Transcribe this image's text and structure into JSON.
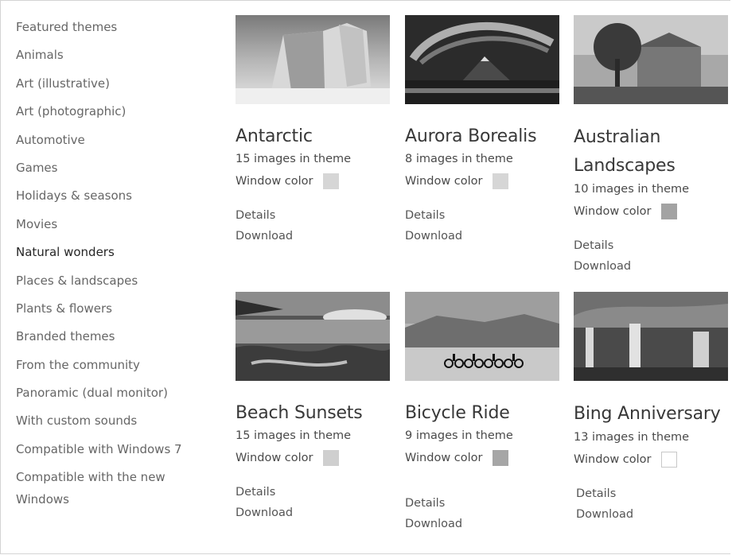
{
  "sidebar": {
    "items": [
      {
        "label": "Featured themes"
      },
      {
        "label": "Animals"
      },
      {
        "label": "Art (illustrative)"
      },
      {
        "label": "Art (photographic)"
      },
      {
        "label": "Automotive"
      },
      {
        "label": "Games"
      },
      {
        "label": "Holidays & seasons"
      },
      {
        "label": "Movies"
      },
      {
        "label": "Natural wonders"
      },
      {
        "label": "Places & landscapes"
      },
      {
        "label": "Plants & flowers"
      },
      {
        "label": "Branded themes"
      },
      {
        "label": "From the community"
      },
      {
        "label": "Panoramic (dual monitor)"
      },
      {
        "label": "With custom sounds"
      },
      {
        "label": "Compatible with Windows 7"
      },
      {
        "label": "Compatible with the new Windows"
      }
    ],
    "active": "Natural wonders"
  },
  "themes": [
    {
      "title": "Antarctic",
      "count": "15 images in theme",
      "window_color_label": "Window color",
      "window_color": "#d6d6d6",
      "details": "Details",
      "download": "Download"
    },
    {
      "title": "Aurora Borealis",
      "count": "8 images in theme",
      "window_color_label": "Window color",
      "window_color": "#d6d6d6",
      "details": "Details",
      "download": "Download"
    },
    {
      "title": "Australian Landscapes",
      "count": "10 images in theme",
      "window_color_label": "Window color",
      "window_color": "#a3a3a3",
      "details": "Details",
      "download": "Download"
    },
    {
      "title": "Beach Sunsets",
      "count": "15 images in theme",
      "window_color_label": "Window color",
      "window_color": "#cfcfcf",
      "details": "Details",
      "download": "Download"
    },
    {
      "title": "Bicycle Ride",
      "count": "9 images in theme",
      "window_color_label": "Window color",
      "window_color": "#a6a6a6",
      "details": "Details",
      "download": "Download"
    },
    {
      "title": "Bing Anniversary",
      "count": "13 images in theme",
      "window_color_label": "Window color",
      "window_color": "#ffffff",
      "details": "Details",
      "download": "Download"
    }
  ]
}
